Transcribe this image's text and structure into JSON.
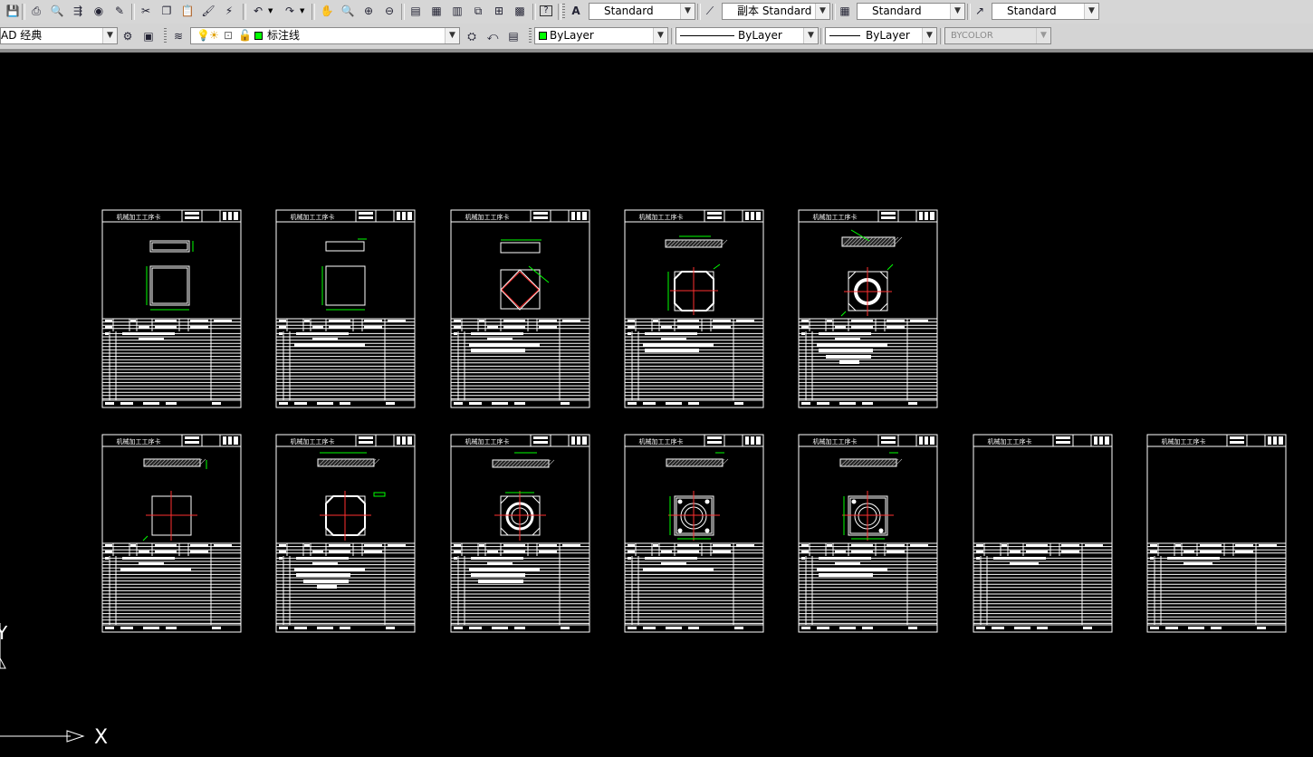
{
  "toolbar_top": {
    "buttons": [
      "save-icon",
      "print-icon",
      "print-preview-icon",
      "publish-icon",
      "3d-dwf-icon",
      "etransmit-icon",
      "cut-icon",
      "copy-icon",
      "paste-icon",
      "match-properties-icon",
      "block-editor-icon",
      "undo-icon",
      "redo-icon",
      "pan-icon",
      "zoom-realtime-icon",
      "zoom-window-icon",
      "zoom-previous-icon",
      "properties-icon",
      "design-center-icon",
      "tool-palettes-icon",
      "sheet-set-icon",
      "markup-icon",
      "calculator-icon",
      "help-icon"
    ],
    "text_style": "Standard",
    "dim_style": "副本 Standard",
    "table_style": "Standard",
    "multileader_style": "Standard"
  },
  "toolbar_layers": {
    "workspace": "AD 经典",
    "layer": "标注线",
    "color": "ByLayer",
    "linetype": "ByLayer",
    "lineweight": "ByLayer",
    "plotstyle": "BYCOLOR"
  },
  "canvas": {
    "sheet_title": "机械加工工序卡",
    "ucs_x_label": "X",
    "ucs_y_label": "Y"
  },
  "colors": {
    "background": "#000000",
    "line": "#ffffff",
    "dimension": "#00ff00",
    "centerline": "#ff0000",
    "toolbar": "#d6d6d6"
  }
}
